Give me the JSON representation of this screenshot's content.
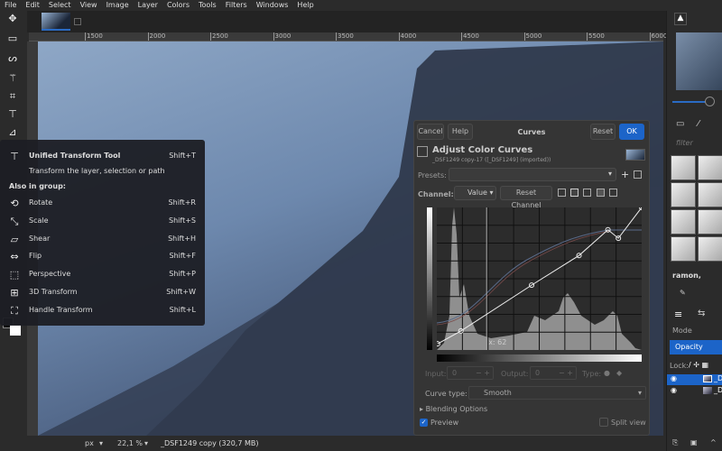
{
  "menu": [
    "File",
    "Edit",
    "Select",
    "View",
    "Image",
    "Layer",
    "Colors",
    "Tools",
    "Filters",
    "Windows",
    "Help"
  ],
  "ruler": {
    "labels": [
      "1500",
      "2000",
      "2500",
      "3000",
      "3500",
      "4000",
      "4500",
      "5000",
      "5500",
      "6000"
    ]
  },
  "tooltip": {
    "title": "Unified Transform Tool",
    "shortcut": "Shift+T",
    "description": "Transform the layer, selection or path",
    "group_label": "Also in group:",
    "items": [
      {
        "label": "Rotate",
        "shortcut": "Shift+R",
        "icon": "rotate-icon"
      },
      {
        "label": "Scale",
        "shortcut": "Shift+S",
        "icon": "scale-icon"
      },
      {
        "label": "Shear",
        "shortcut": "Shift+H",
        "icon": "shear-icon"
      },
      {
        "label": "Flip",
        "shortcut": "Shift+F",
        "icon": "flip-icon"
      },
      {
        "label": "Perspective",
        "shortcut": "Shift+P",
        "icon": "perspective-icon"
      },
      {
        "label": "3D Transform",
        "shortcut": "Shift+W",
        "icon": "3d-transform-icon"
      },
      {
        "label": "Handle Transform",
        "shortcut": "Shift+L",
        "icon": "handle-transform-icon"
      }
    ]
  },
  "dialog": {
    "cancel": "Cancel",
    "help": "Help",
    "title": "Curves",
    "reset": "Reset",
    "ok": "OK",
    "heading": "Adjust Color Curves",
    "subheading": "_DSF1249 copy-17 ([_DSF1249] (imported))",
    "presets_label": "Presets:",
    "presets_value": "",
    "channel_label": "Channel:",
    "channel_value": "Value",
    "reset_channel": "Reset Channel",
    "cursor_readout": "x: 62",
    "input_label": "Input:",
    "input_value": "0",
    "output_label": "Output:",
    "output_value": "0",
    "type_label": "Type:",
    "curve_type_label": "Curve type:",
    "curve_type_value": "Smooth",
    "blending": "Blending Options",
    "preview": "Preview",
    "preview_checked": true,
    "split_view": "Split view",
    "split_checked": false,
    "accent": "#1c64c8",
    "curve_points": [
      [
        1,
        11
      ],
      [
        30,
        34
      ],
      [
        118,
        116
      ],
      [
        177,
        169
      ],
      [
        213,
        215
      ],
      [
        226,
        200
      ],
      [
        255,
        255
      ]
    ]
  },
  "status": {
    "unit": "px",
    "zoom": "22,1 %",
    "file": "_DSF1249 copy (320,7 MB)"
  },
  "right_panel": {
    "filter_placeholder": "filter",
    "brush_name": "ramon,",
    "mode_label": "Mode",
    "opacity_label": "Opacity",
    "lock_label": "Lock:",
    "layers": [
      "_D",
      "_D"
    ]
  }
}
